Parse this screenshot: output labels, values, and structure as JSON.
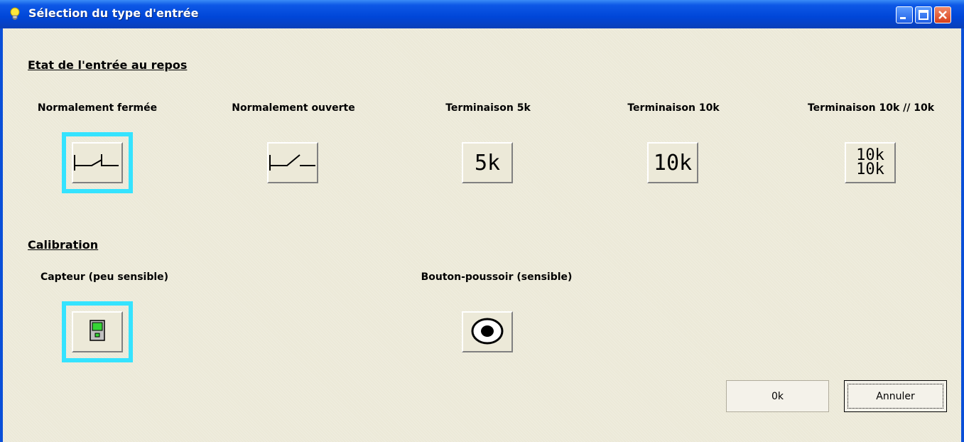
{
  "window": {
    "title": "Sélection du type d'entrée"
  },
  "section_rest": {
    "title": "Etat de l'entrée au repos"
  },
  "rest_options": [
    {
      "label": "Normalement fermée",
      "selected": true,
      "icon": "nc-contact-icon"
    },
    {
      "label": "Normalement ouverte",
      "selected": false,
      "icon": "no-contact-icon"
    },
    {
      "label": "Terminaison 5k",
      "selected": false,
      "icon_text": "5k"
    },
    {
      "label": "Terminaison 10k",
      "selected": false,
      "icon_text": "10k"
    },
    {
      "label": "Terminaison 10k // 10k",
      "selected": false,
      "icon_text_top": "10k",
      "icon_text_bottom": "10k"
    }
  ],
  "section_calibration": {
    "title": "Calibration"
  },
  "calibration_options": [
    {
      "label": "Capteur (peu sensible)",
      "selected": true,
      "icon": "sensor-device-icon"
    },
    {
      "label": "Bouton-poussoir (sensible)",
      "selected": false,
      "icon": "push-button-icon"
    }
  ],
  "buttons": {
    "ok": "0k",
    "cancel": "Annuler"
  },
  "colors": {
    "selection": "#35e3ff",
    "titlebar": "#0046d8",
    "background": "#ece9d8"
  }
}
